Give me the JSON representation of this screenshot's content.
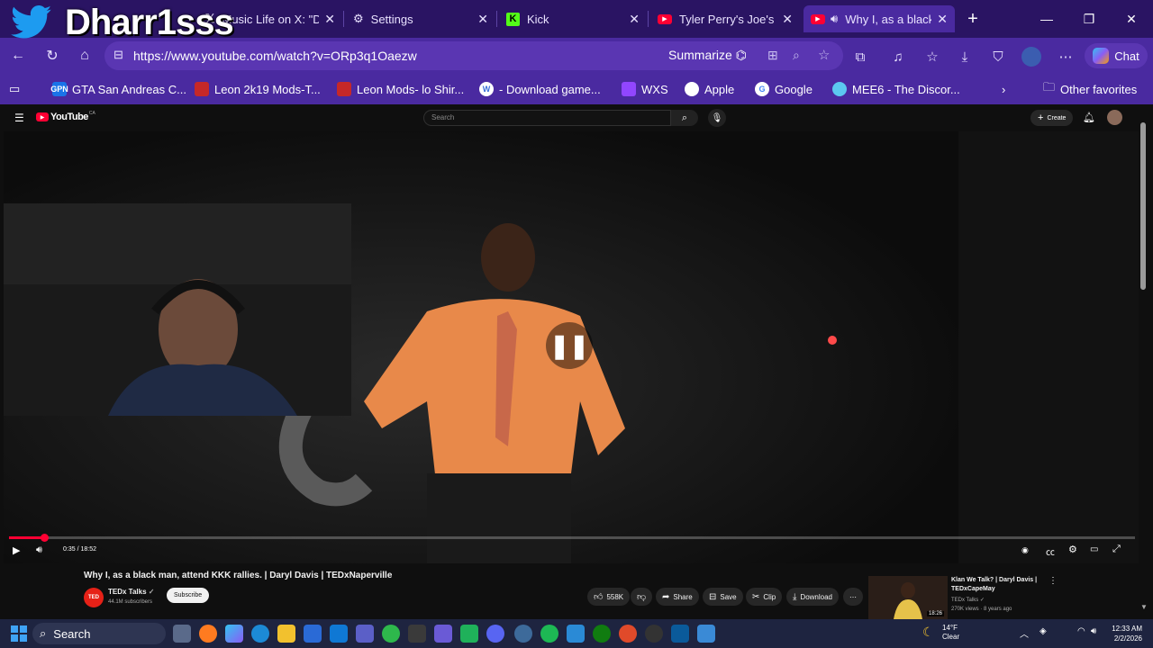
{
  "overlay": {
    "streamer_name": "Dharr1sss"
  },
  "browser": {
    "tabs": [
      {
        "label": "Music Life on X: \"D",
        "active": false
      },
      {
        "label": "Settings",
        "active": false
      },
      {
        "label": "Kick",
        "active": false
      },
      {
        "label": "Tyler Perry's Joe's Co",
        "active": false
      },
      {
        "label": "Why I, as a black",
        "active": true
      }
    ],
    "url": "https://www.youtube.com/watch?v=ORp3q1Oaezw",
    "summarize_label": "Summarize",
    "chat_label": "Chat",
    "favorites": [
      {
        "label": "GTA San Andreas C...",
        "icon": "GPN",
        "color": "#1a73e8"
      },
      {
        "label": "Leon 2k19 Mods-T...",
        "icon": "",
        "color": "#c62828"
      },
      {
        "label": "Leon Mods- lo Shir...",
        "icon": "",
        "color": "#c62828"
      },
      {
        "label": "- Download game...",
        "icon": "W",
        "color": "#3a6fd8"
      },
      {
        "label": "WXS",
        "icon": "",
        "color": "#9146ff"
      },
      {
        "label": "Apple",
        "icon": "",
        "color": "#111111"
      },
      {
        "label": "Google",
        "icon": "G",
        "color": "#ffffff"
      },
      {
        "label": "MEE6 - The Discor...",
        "icon": "",
        "color": "#5cc8f0"
      }
    ],
    "other_favorites": "Other favorites"
  },
  "youtube": {
    "logo_text": "YouTube",
    "logo_region": "CA",
    "search_placeholder": "Search",
    "create_label": "Create",
    "player": {
      "time": "0:35 / 18:52",
      "progress_fraction": 0.031
    },
    "video_title": "Why I, as a black man, attend KKK rallies. | Daryl Davis | TEDxNaperville",
    "channel_name": "TEDx Talks",
    "subscribers": "44.1M subscribers",
    "subscribe_label": "Subscribe",
    "likes": "558K",
    "share_label": "Share",
    "save_label": "Save",
    "clip_label": "Clip",
    "download_label": "Download",
    "recommended": {
      "title_line1": "Klan We Talk? | Daryl Davis |",
      "title_line2": "TEDxCapeMay",
      "channel": "TEDx Talks",
      "meta": "270K views · 8 years ago",
      "duration": "18:26"
    }
  },
  "taskbar": {
    "search_label": "Search",
    "weather_temp": "14°F",
    "weather_desc": "Clear",
    "time": "12:33 AM",
    "date": "2/2/2026"
  }
}
